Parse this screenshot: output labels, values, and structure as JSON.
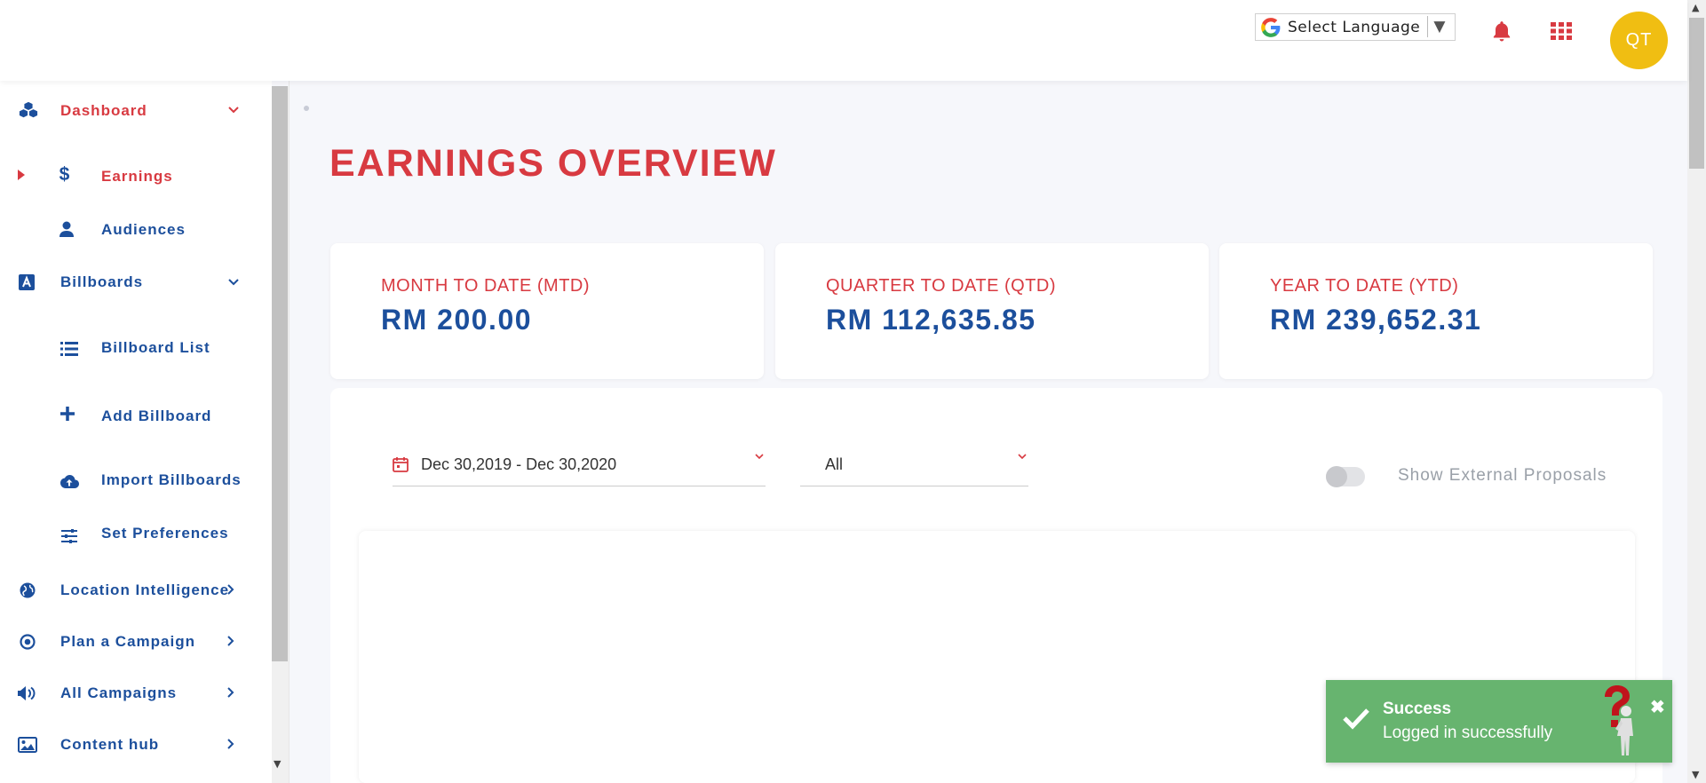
{
  "header": {
    "language_label": "Select Language",
    "language_arrow": "▼",
    "avatar_initials": "QT"
  },
  "sidebar": {
    "items": [
      {
        "label": "Dashboard",
        "icon": "cubes-icon",
        "active": true
      },
      {
        "label": "Earnings",
        "icon": "dollar-icon",
        "active": true
      },
      {
        "label": "Audiences",
        "icon": "user-icon"
      },
      {
        "label": "Billboards",
        "icon": "billboard-a-icon"
      },
      {
        "label": "Billboard List",
        "icon": "list-icon"
      },
      {
        "label": "Add Billboard",
        "icon": "plus-icon"
      },
      {
        "label": "Import Billboards",
        "icon": "cloud-upload-icon"
      },
      {
        "label": "Set Preferences",
        "icon": "sliders-icon"
      },
      {
        "label": "Location Intelligence",
        "icon": "globe-icon"
      },
      {
        "label": "Plan a Campaign",
        "icon": "target-icon"
      },
      {
        "label": "All Campaigns",
        "icon": "megaphone-icon"
      },
      {
        "label": "Content hub",
        "icon": "image-icon"
      }
    ]
  },
  "main": {
    "title": "EARNINGS OVERVIEW",
    "cards": [
      {
        "title": "MONTH TO DATE (MTD)",
        "value": "RM 200.00"
      },
      {
        "title": "QUARTER TO DATE (QTD)",
        "value": "RM 112,635.85"
      },
      {
        "title": "YEAR TO DATE (YTD)",
        "value": "RM 239,652.31"
      }
    ],
    "filters": {
      "date_range": "Dec 30,2019 - Dec 30,2020",
      "selection": "All",
      "toggle_label": "Show External Proposals",
      "toggle_on": false
    }
  },
  "toast": {
    "title": "Success",
    "message": "Logged in successfully",
    "color": "#67b46f"
  },
  "colors": {
    "accent_red": "#d83a41",
    "brand_blue": "#1c4f9c",
    "avatar_yellow": "#f0be12"
  }
}
